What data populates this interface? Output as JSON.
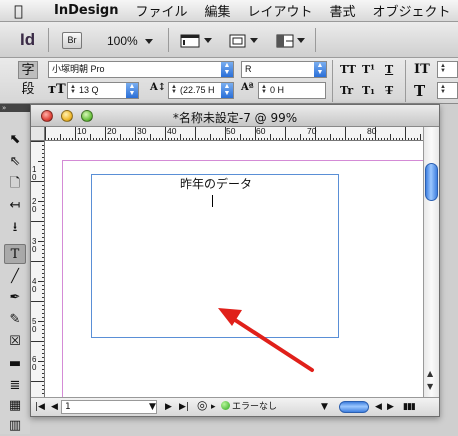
{
  "menubar": {
    "app_name": "InDesign",
    "items": [
      "ファイル",
      "編集",
      "レイアウト",
      "書式",
      "オブジェクト"
    ]
  },
  "appbar": {
    "logo": "Id",
    "bridge_label": "Br",
    "zoom_value": "100%"
  },
  "control": {
    "char_mode_label": "字",
    "para_mode_label": "段",
    "font_family": "小塚明朝 Pro",
    "font_style": "R",
    "font_size": "13 Q",
    "leading": "(22.75 H",
    "tracking": "0 H",
    "icons": [
      "TT",
      "T¹",
      "T",
      "Tr",
      "T₁",
      "T̶",
      "IT",
      "T"
    ]
  },
  "document": {
    "title": "*名称未設定-7 @ 99%",
    "h_ruler_labels": [
      "10",
      "20",
      "30",
      "40",
      "50",
      "60",
      "70",
      "80"
    ],
    "v_ruler_labels": [
      "1\n0",
      "2\n0",
      "3\n0",
      "4\n0",
      "5\n0",
      "6\n0"
    ],
    "frame_text": "昨年のデータ"
  },
  "statusbar": {
    "page_number": "1",
    "preflight_status": "エラーなし"
  },
  "colors": {
    "frame_border": "#5a8fd6",
    "margin_guide": "#d48bd6",
    "annotation_arrow": "#e0201a"
  }
}
